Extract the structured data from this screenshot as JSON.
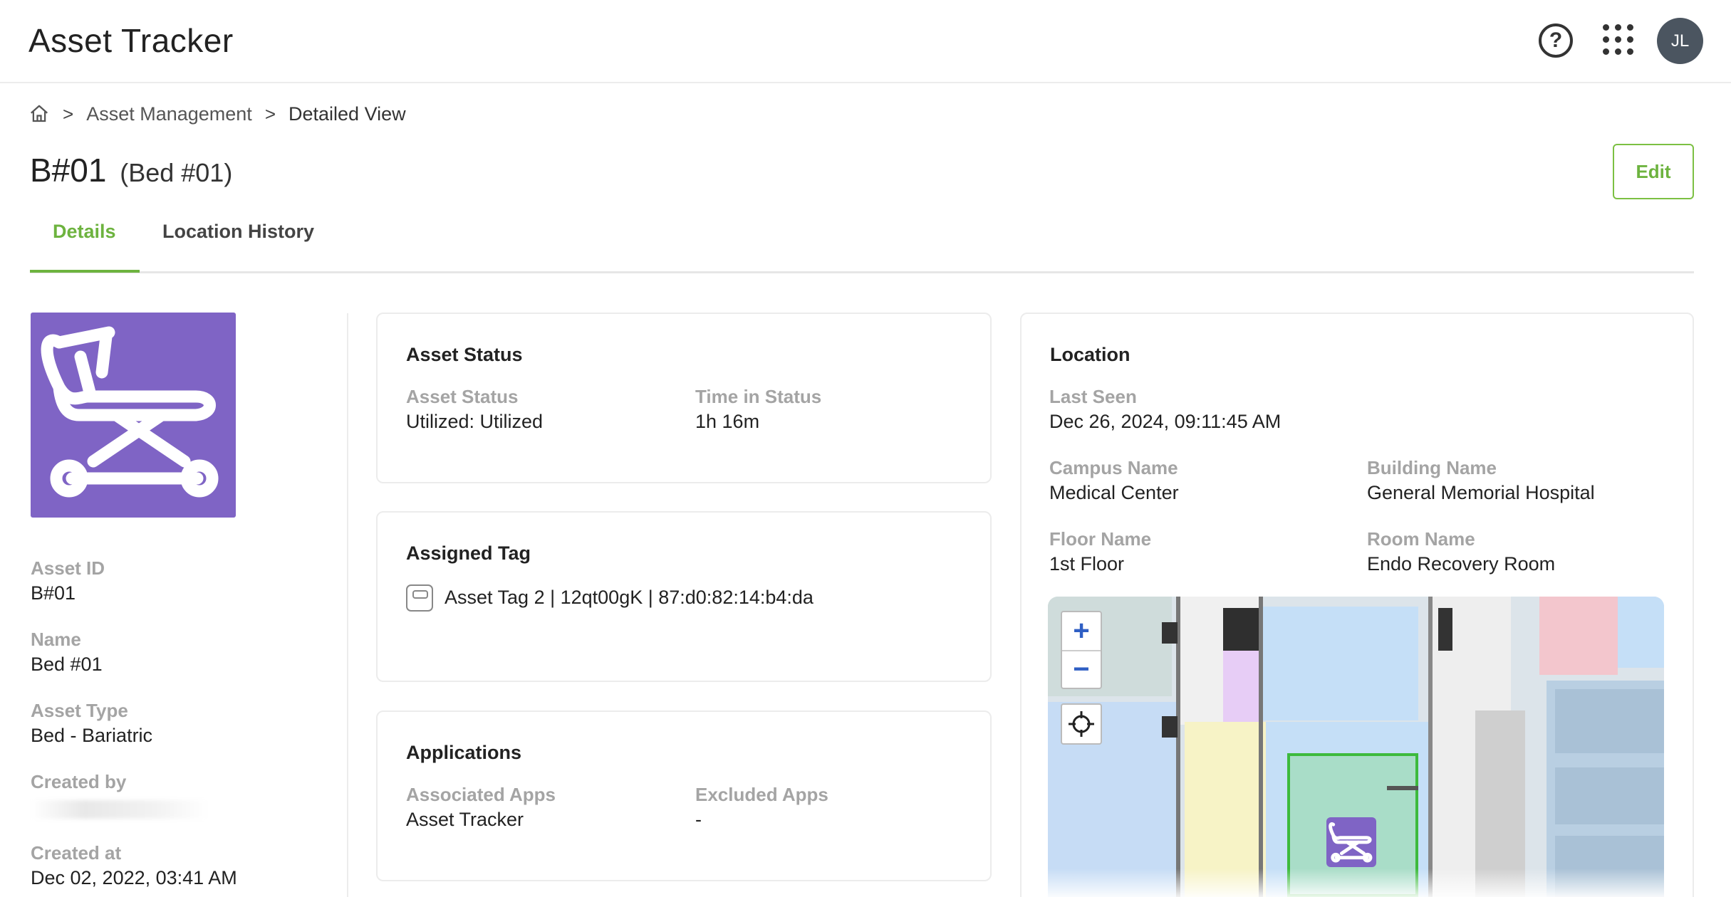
{
  "header": {
    "app_title": "Asset Tracker",
    "help_icon": "question-circle-icon",
    "apps_icon": "grid-dots-icon",
    "avatar_initials": "JL"
  },
  "breadcrumb": {
    "home_icon": "home-icon",
    "items": [
      "Asset Management",
      "Detailed View"
    ]
  },
  "asset": {
    "code": "B#01",
    "name_paren": "(Bed #01)",
    "icon": "bariatric-bed-icon",
    "image_background": "#7F64C5"
  },
  "actions": {
    "edit_label": "Edit"
  },
  "tabs": [
    {
      "label": "Details",
      "active": true
    },
    {
      "label": "Location History",
      "active": false
    }
  ],
  "details": {
    "asset_id_label": "Asset ID",
    "asset_id": "B#01",
    "name_label": "Name",
    "name": "Bed #01",
    "asset_type_label": "Asset Type",
    "asset_type": "Bed - Bariatric",
    "created_by_label": "Created by",
    "created_at_label": "Created at",
    "created_at": "Dec 02, 2022, 03:41 AM"
  },
  "asset_status_card": {
    "title": "Asset Status",
    "status_label": "Asset Status",
    "status_value": "Utilized: Utilized",
    "time_label": "Time in Status",
    "time_value": "1h 16m"
  },
  "assigned_tag_card": {
    "title": "Assigned Tag",
    "tag_icon": "tag-icon",
    "tag_text": "Asset Tag 2 | 12qt00gK | 87:d0:82:14:b4:da"
  },
  "applications_card": {
    "title": "Applications",
    "associated_label": "Associated Apps",
    "associated_value": "Asset Tracker",
    "excluded_label": "Excluded Apps",
    "excluded_value": "-"
  },
  "location_card": {
    "title": "Location",
    "last_seen_label": "Last Seen",
    "last_seen": "Dec 26, 2024, 09:11:45 AM",
    "campus_label": "Campus Name",
    "campus": "Medical Center",
    "building_label": "Building Name",
    "building": "General Memorial Hospital",
    "floor_label": "Floor Name",
    "floor": "1st Floor",
    "room_label": "Room Name",
    "room": "Endo Recovery Room",
    "map": {
      "zoom_in": "+",
      "zoom_out": "−",
      "locate_icon": "crosshair-icon",
      "marker_icon": "bariatric-bed-icon"
    }
  },
  "colors": {
    "accent": "#6DB33F",
    "asset_purple": "#7F64C5",
    "label_gray": "#A4A4A4",
    "zoom_blue": "#2F5FC4",
    "room_highlight": "#3DBA3D"
  }
}
